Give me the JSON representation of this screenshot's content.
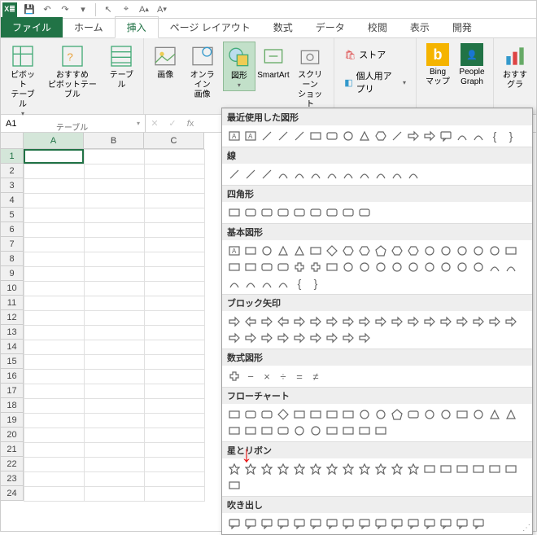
{
  "qat": {
    "save": "💾",
    "undo": "↶",
    "redo": "↷"
  },
  "tabs": {
    "file": "ファイル",
    "home": "ホーム",
    "insert": "挿入",
    "pagelayout": "ページ レイアウト",
    "formulas": "数式",
    "data": "データ",
    "review": "校閲",
    "view": "表示",
    "dev": "開発"
  },
  "ribbon": {
    "pivot": "ピボット\nテーブル",
    "recpivot": "おすすめ\nピボットテーブル",
    "table": "テーブル",
    "tables_group": "テーブル",
    "picture": "画像",
    "online_pic": "オンライン\n画像",
    "shapes": "図形",
    "smartart": "SmartArt",
    "screenshot": "スクリーン\nショット",
    "store": "ストア",
    "myapps": "個人用アプリ",
    "bing": "Bing\nマップ",
    "people": "People\nGraph",
    "reccharts": "おすす\nグラ"
  },
  "namebox": {
    "value": "A1"
  },
  "cols": [
    "A",
    "B",
    "C"
  ],
  "rows": [
    "1",
    "2",
    "3",
    "4",
    "5",
    "6",
    "7",
    "8",
    "9",
    "10",
    "11",
    "12",
    "13",
    "14",
    "15",
    "16",
    "17",
    "18",
    "19",
    "20",
    "21",
    "22",
    "23",
    "24"
  ],
  "shapes_menu": {
    "cat1": "最近使用した図形",
    "cat2": "線",
    "cat3": "四角形",
    "cat4": "基本図形",
    "cat5": "ブロック矢印",
    "cat6": "数式図形",
    "cat7": "フローチャート",
    "cat8": "星とリボン",
    "cat9": "吹き出し"
  }
}
